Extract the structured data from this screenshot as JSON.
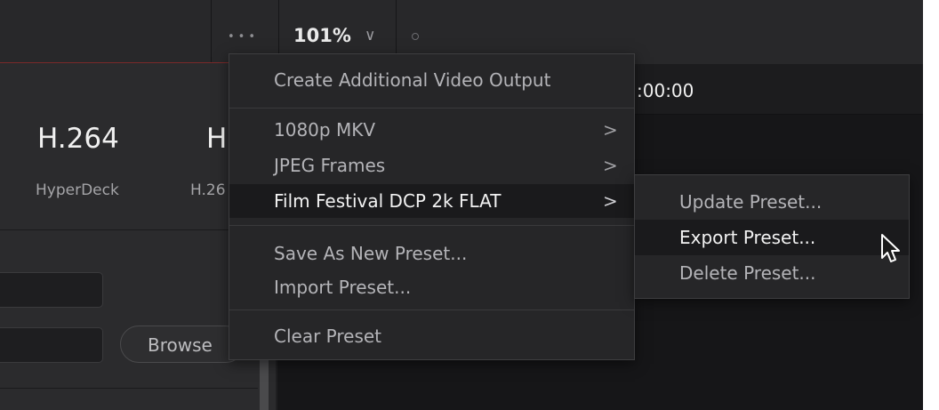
{
  "toolbar": {
    "more_label": "•••",
    "zoom_value": "101%",
    "zoom_dropdown_icon": "chevron-down-icon",
    "status_icon": "circle-indicator-icon"
  },
  "left_panel": {
    "presets": [
      {
        "name": "H.264",
        "sub": "HyperDeck"
      },
      {
        "name": "H",
        "sub": "H.26"
      }
    ],
    "browse_label": "Browse"
  },
  "viewer": {
    "timecode": ":00:00"
  },
  "context_menu": {
    "create_output": "Create Additional Video Output",
    "presets": [
      {
        "label": "1080p MKV",
        "arrow": ">"
      },
      {
        "label": "JPEG Frames",
        "arrow": ">"
      },
      {
        "label": "Film Festival DCP 2k FLAT",
        "arrow": ">"
      }
    ],
    "save_as_new": "Save As New Preset...",
    "import": "Import Preset...",
    "clear": "Clear Preset"
  },
  "submenu": {
    "items": [
      "Update Preset...",
      "Export Preset...",
      "Delete Preset..."
    ]
  },
  "colors": {
    "background": "#1f1f21",
    "menu_bg": "#262628",
    "highlight": "#1a1a1c",
    "text_primary": "#f2f2f2",
    "text_secondary": "#b4b4b8"
  }
}
